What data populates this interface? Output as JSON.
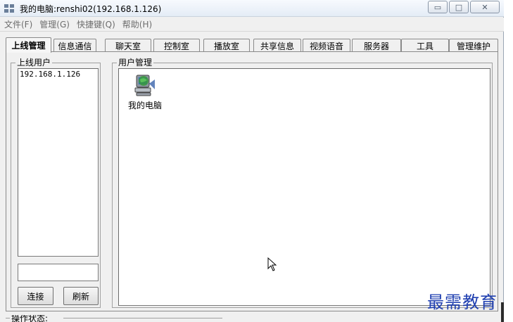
{
  "window": {
    "title": "我的电脑:renshi02(192.168.1.126)",
    "controls": {
      "minimize": "▭",
      "maximize": "□",
      "close": "✕"
    }
  },
  "menu": [
    "文件(F)",
    "管理(G)",
    "快捷键(Q)",
    "帮助(H)"
  ],
  "tabs": [
    {
      "label": "上线管理",
      "active": true
    },
    {
      "label": "信息通信"
    },
    {
      "label": "聊天室"
    },
    {
      "label": "控制室"
    },
    {
      "label": "播放室"
    },
    {
      "label": "共享信息"
    },
    {
      "label": "视频语音"
    },
    {
      "label": "服务器"
    },
    {
      "label": "工具"
    },
    {
      "label": "管理维护"
    }
  ],
  "online_users": {
    "legend": "上线用户",
    "items": [
      "192.168.1.126"
    ],
    "connect_label": "连接",
    "refresh_label": "刷新"
  },
  "user_management": {
    "legend": "用户管理",
    "computer_label": "我的电脑"
  },
  "status": {
    "legend": "操作状态:"
  },
  "watermark": "最需教育"
}
